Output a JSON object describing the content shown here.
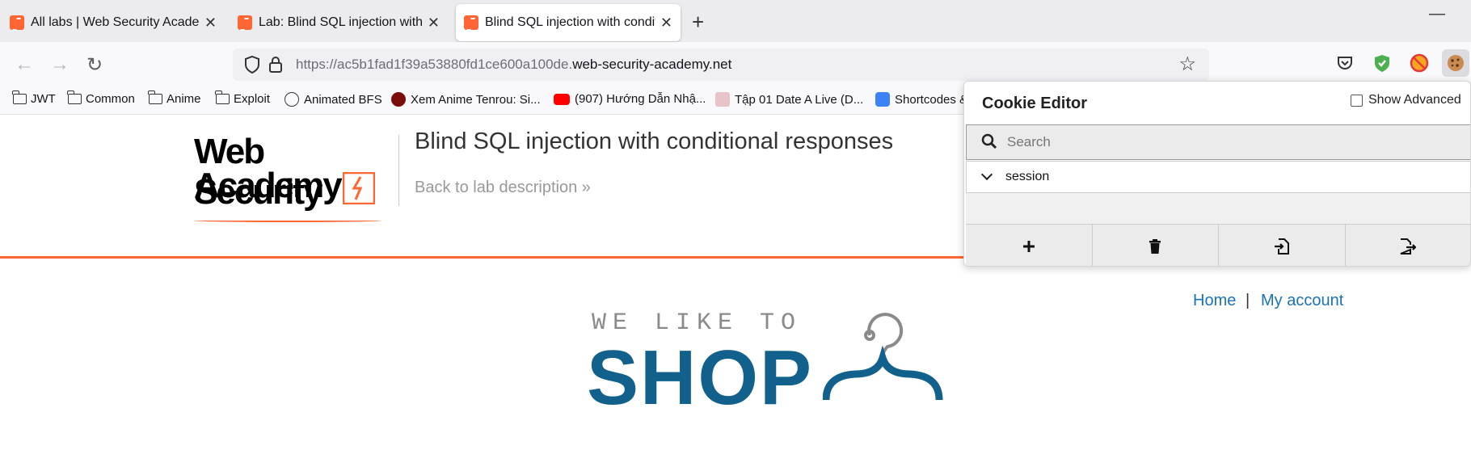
{
  "tabs": [
    {
      "title": "All labs | Web Security Academy"
    },
    {
      "title": "Lab: Blind SQL injection with co"
    },
    {
      "title": "Blind SQL injection with conditi"
    }
  ],
  "urlbar": {
    "url_prefix": "https://ac5b1fad1f39a53880fd1ce600a100de.",
    "url_domain": "web-security-academy.net"
  },
  "bookmarks": [
    {
      "label": "JWT",
      "icon": "folder-icon"
    },
    {
      "label": "Common",
      "icon": "folder-icon"
    },
    {
      "label": "Anime",
      "icon": "folder-icon"
    },
    {
      "label": "Exploit",
      "icon": "folder-icon"
    },
    {
      "label": "Animated BFS",
      "icon": "globe-icon"
    },
    {
      "label": "Xem Anime Tenrou: Si...",
      "icon": "site-icon"
    },
    {
      "label": "(907) Hướng Dẫn Nhậ...",
      "icon": "youtube-icon"
    },
    {
      "label": "Tập 01 Date A Live (D...",
      "icon": "anime-icon"
    },
    {
      "label": "Shortcodes &",
      "icon": "rocket-icon"
    }
  ],
  "page": {
    "logo_line1": "Web Security",
    "logo_line2": "Academy",
    "lab_title": "Blind SQL injection with conditional responses",
    "back_link": "Back to lab description »",
    "home": "Home",
    "separator": "|",
    "my_account": "My account",
    "shop_tagline": "WE LIKE TO",
    "shop_word": "SHOP"
  },
  "cookie_editor": {
    "title": "Cookie Editor",
    "show_advanced": "Show Advanced",
    "search_placeholder": "Search",
    "cookies": [
      {
        "name": "session"
      }
    ]
  },
  "colors": {
    "accent": "#ff6633",
    "link": "#1a73b5",
    "shop_blue": "#11618c"
  }
}
